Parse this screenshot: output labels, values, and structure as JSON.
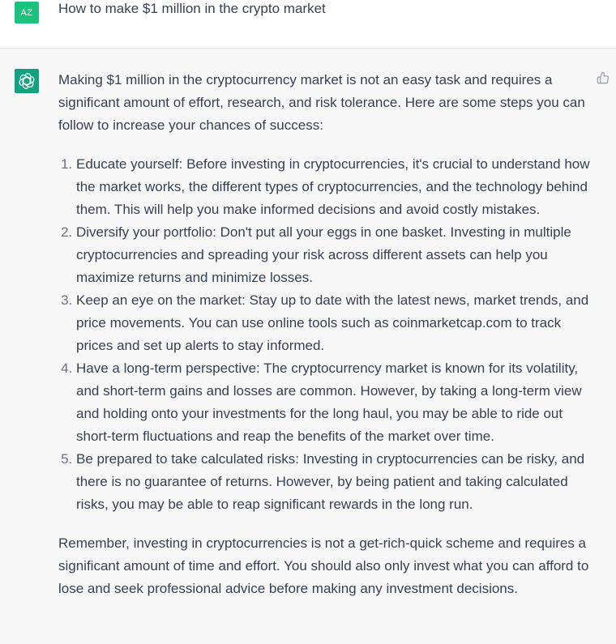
{
  "user_message": {
    "avatar_initials": "AZ",
    "text": "How to make $1 million in the crypto market"
  },
  "assistant_message": {
    "avatar_icon": "openai-logo-icon",
    "intro": "Making $1 million in the cryptocurrency market is not an easy task and requires a significant amount of effort, research, and risk tolerance. Here are some steps you can follow to increase your chances of success:",
    "steps": [
      "Educate yourself: Before investing in cryptocurrencies, it's crucial to understand how the market works, the different types of cryptocurrencies, and the technology behind them. This will help you make informed decisions and avoid costly mistakes.",
      "Diversify your portfolio: Don't put all your eggs in one basket. Investing in multiple cryptocurrencies and spreading your risk across different assets can help you maximize returns and minimize losses.",
      "Keep an eye on the market: Stay up to date with the latest news, market trends, and price movements. You can use online tools such as coinmarketcap.com to track prices and set up alerts to stay informed.",
      "Have a long-term perspective: The cryptocurrency market is known for its volatility, and short-term gains and losses are common. However, by taking a long-term view and holding onto your investments for the long haul, you may be able to ride out short-term fluctuations and reap the benefits of the market over time.",
      "Be prepared to take calculated risks: Investing in cryptocurrencies can be risky, and there is no guarantee of returns. However, by being patient and taking calculated risks, you may be able to reap significant rewards in the long run."
    ],
    "conclusion": "Remember, investing in cryptocurrencies is not a get-rich-quick scheme and requires a significant amount of time and effort. You should also only invest what you can afford to lose and seek professional advice before making any investment decisions."
  },
  "colors": {
    "user_avatar": "#19c37d",
    "bot_avatar": "#10a37f",
    "assistant_background": "#f7f7f8",
    "text": "#374151"
  }
}
